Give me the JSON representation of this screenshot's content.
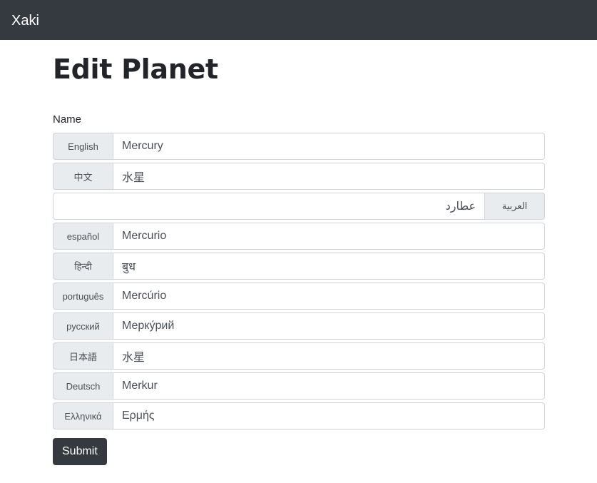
{
  "navbar": {
    "brand": "Xaki"
  },
  "page": {
    "title": "Edit Planet",
    "name_label": "Name",
    "submit_label": "Submit"
  },
  "names": [
    {
      "language": "English",
      "value": "Mercury"
    },
    {
      "language": "中文",
      "value": "水星"
    },
    {
      "language": "العربية",
      "value": "عطارد"
    },
    {
      "language": "español",
      "value": "Mercurio"
    },
    {
      "language": "हिन्दी",
      "value": "बुध"
    },
    {
      "language": "português",
      "value": "Mercúrio"
    },
    {
      "language": "русский",
      "value": "Мерку́рий"
    },
    {
      "language": "日本語",
      "value": "水星"
    },
    {
      "language": "Deutsch",
      "value": "Merkur"
    },
    {
      "language": "Ελληνικά",
      "value": "Ερμής"
    }
  ]
}
